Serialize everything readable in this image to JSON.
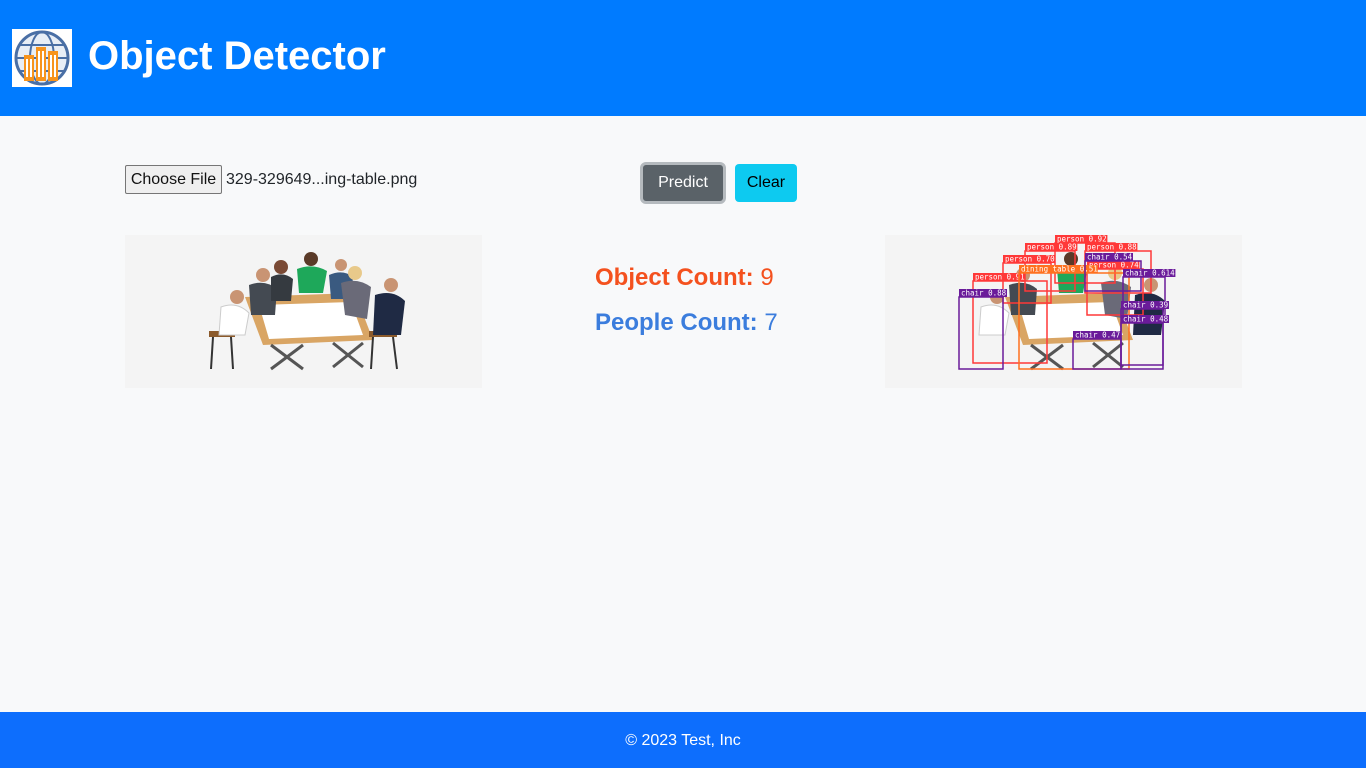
{
  "header": {
    "title": "Object Detector",
    "logo_icon": "building-globe-icon"
  },
  "upload": {
    "choose_file_label": "Choose File",
    "file_name": "329-329649...ing-table.png",
    "predict_label": "Predict",
    "clear_label": "Clear"
  },
  "results": {
    "object_count_label": "Object Count:",
    "object_count_value": "9",
    "people_count_label": "People Count:",
    "people_count_value": "7",
    "object_color": "#f4511e",
    "people_color": "#3b7ddd"
  },
  "detections": [
    {
      "label": "person 0.92"
    },
    {
      "label": "person 0.89"
    },
    {
      "label": "person 0.88"
    },
    {
      "label": "person 0.70"
    },
    {
      "label": "person 0.74"
    },
    {
      "label": "person 0.91"
    },
    {
      "label": "dining table 0.51"
    },
    {
      "label": "chair 0.54"
    },
    {
      "label": "chair 0.614"
    },
    {
      "label": "chair 0.88"
    },
    {
      "label": "chair 0.39"
    },
    {
      "label": "chair 0.48"
    },
    {
      "label": "chair 0.47"
    }
  ],
  "colors": {
    "header_bg": "#007bff",
    "footer_bg": "#0d6efd",
    "person_box": "#ff3838",
    "chair_box": "#6a1b9a",
    "table_box": "#ff701f"
  },
  "footer": {
    "text": "© 2023 Test, Inc"
  }
}
